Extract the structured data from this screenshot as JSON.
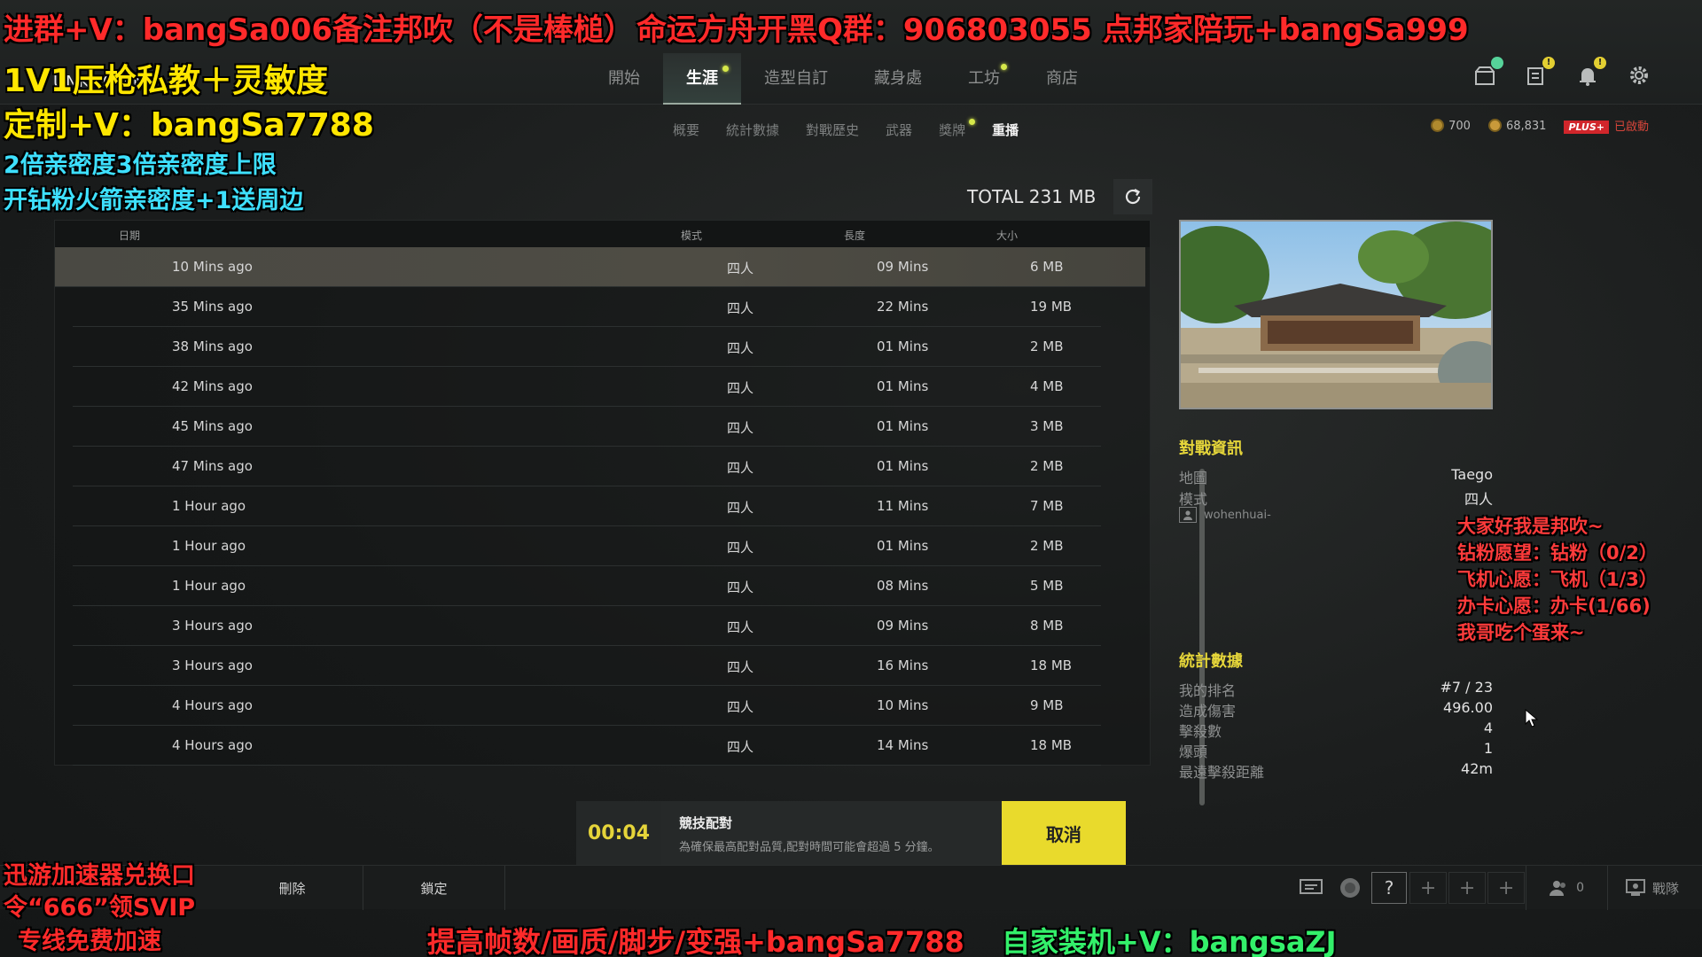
{
  "header": {
    "brand": "UNKNOWN",
    "main_tabs": [
      {
        "label": "開始",
        "active": false,
        "dot": false
      },
      {
        "label": "生涯",
        "active": true,
        "dot": true
      },
      {
        "label": "造型自訂",
        "active": false,
        "dot": false
      },
      {
        "label": "藏身處",
        "active": false,
        "dot": false
      },
      {
        "label": "工坊",
        "active": false,
        "dot": true
      },
      {
        "label": "商店",
        "active": false,
        "dot": false
      }
    ],
    "icons": [
      "store-icon",
      "mission-icon",
      "notification-bell-icon",
      "settings-gear-icon"
    ],
    "sub_tabs": [
      {
        "label": "概要",
        "active": false
      },
      {
        "label": "統計數據",
        "active": false
      },
      {
        "label": "對戰歷史",
        "active": false
      },
      {
        "label": "武器",
        "active": false
      },
      {
        "label": "獎牌",
        "active": false
      },
      {
        "label": "重播",
        "active": true
      }
    ],
    "currency": {
      "g_coin": "700",
      "bp": "68,831",
      "plus_label": "PLUS+",
      "plus_status": "已啟動"
    }
  },
  "replays": {
    "total": "TOTAL 231 MB",
    "columns": {
      "date": "日期",
      "mode": "模式",
      "length": "長度",
      "size": "大小"
    },
    "rows": [
      {
        "date": "10 Mins ago",
        "mode": "四人",
        "length": "09 Mins",
        "size": "6 MB"
      },
      {
        "date": "35 Mins ago",
        "mode": "四人",
        "length": "22 Mins",
        "size": "19 MB"
      },
      {
        "date": "38 Mins ago",
        "mode": "四人",
        "length": "01 Mins",
        "size": "2 MB"
      },
      {
        "date": "42 Mins ago",
        "mode": "四人",
        "length": "01 Mins",
        "size": "4 MB"
      },
      {
        "date": "45 Mins ago",
        "mode": "四人",
        "length": "01 Mins",
        "size": "3 MB"
      },
      {
        "date": "47 Mins ago",
        "mode": "四人",
        "length": "01 Mins",
        "size": "2 MB"
      },
      {
        "date": "1 Hour ago",
        "mode": "四人",
        "length": "11 Mins",
        "size": "7 MB"
      },
      {
        "date": "1 Hour ago",
        "mode": "四人",
        "length": "01 Mins",
        "size": "2 MB"
      },
      {
        "date": "1 Hour ago",
        "mode": "四人",
        "length": "08 Mins",
        "size": "5 MB"
      },
      {
        "date": "3 Hours ago",
        "mode": "四人",
        "length": "09 Mins",
        "size": "8 MB"
      },
      {
        "date": "3 Hours ago",
        "mode": "四人",
        "length": "16 Mins",
        "size": "18 MB"
      },
      {
        "date": "4 Hours ago",
        "mode": "四人",
        "length": "10 Mins",
        "size": "9 MB"
      },
      {
        "date": "4 Hours ago",
        "mode": "四人",
        "length": "14 Mins",
        "size": "18 MB"
      }
    ]
  },
  "match_info": {
    "title": "對戰資訊",
    "map_label": "地圖",
    "map_value": "Taego",
    "mode_label": "模式",
    "mode_value": "四人",
    "player": "wohenhuai-"
  },
  "stats": {
    "title": "統計數據",
    "items": [
      {
        "label": "我的排名",
        "value": "#7 / 23"
      },
      {
        "label": "造成傷害",
        "value": "496.00"
      },
      {
        "label": "擊殺數",
        "value": "4"
      },
      {
        "label": "爆頭",
        "value": "1"
      },
      {
        "label": "最遠擊殺距離",
        "value": "42m"
      }
    ]
  },
  "matchmaking": {
    "timer": "00:04",
    "title": "競技配對",
    "subtitle": "為確保最高配對品質,配對時間可能會超過 5 分鐘。",
    "cancel": "取消"
  },
  "bottom": {
    "btn_delete": "刪除",
    "btn_lock": "鎖定",
    "help": "?",
    "friends_count": "0",
    "clan": "戰隊"
  },
  "overlay": {
    "top_banner_1": "进群+V：bangSa006备注邦吹（不是棒槌）",
    "top_banner_2": "命运方舟开黑Q群：906803055",
    "top_banner_3": "点邦家陪玩+bangSa999",
    "left_1": "1V1压枪私教＋灵敏度",
    "left_2": "定制+V：bangSa7788",
    "left_3": "2倍亲密度3倍亲密度上限",
    "left_4": "开钻粉火箭亲密度+1送周边",
    "right_1": "大家好我是邦吹~",
    "right_2": "钻粉愿望：钻粉（0/2）",
    "right_3": "飞机心愿：飞机（1/3）",
    "right_4": "办卡心愿：办卡(1/66)",
    "right_5": "我哥吃个蛋来~",
    "bl_1": "迅游加速器兑换口",
    "bl_2": "令“666”领SVIP",
    "bl_3": "专线免费加速",
    "bottom_banner_1": "提高帧数/画质/脚步/变强+bangSa7788",
    "bottom_banner_2": "自家装机+V：bangsaZJ"
  },
  "colors": {
    "accent_yellow": "#e9da2c",
    "plus_red": "#d1262b",
    "selected_row": "#4e4c44"
  }
}
